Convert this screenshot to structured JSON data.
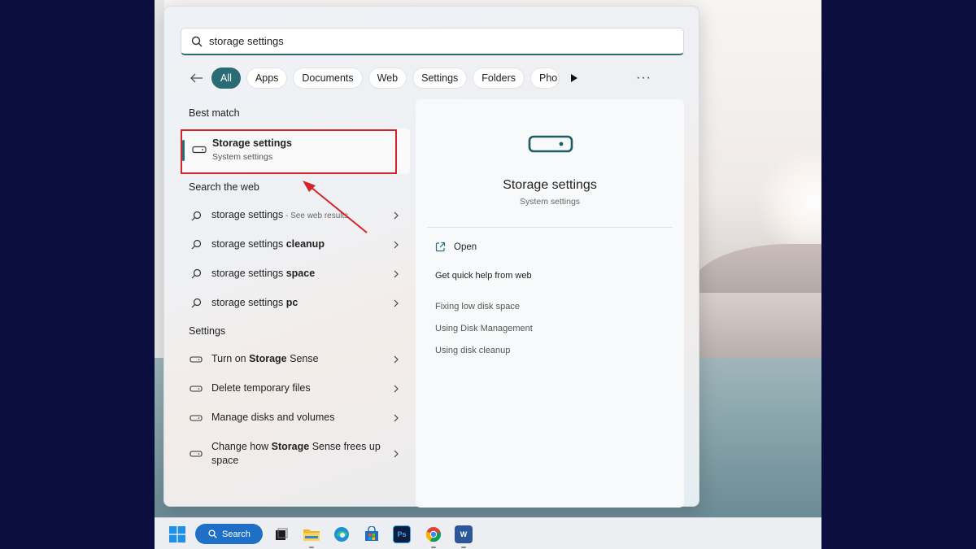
{
  "search": {
    "query": "storage settings"
  },
  "filters": [
    "All",
    "Apps",
    "Documents",
    "Web",
    "Settings",
    "Folders",
    "Pho"
  ],
  "active_filter": "All",
  "more_label": "···",
  "best_match": {
    "header": "Best match",
    "title": "Storage settings",
    "subtitle": "System settings"
  },
  "web": {
    "header": "Search the web",
    "items": [
      {
        "pre": "storage settings",
        "bold": "",
        "suffix": " - See web results"
      },
      {
        "pre": "storage settings ",
        "bold": "cleanup",
        "suffix": ""
      },
      {
        "pre": "storage settings ",
        "bold": "space",
        "suffix": ""
      },
      {
        "pre": "storage settings ",
        "bold": "pc",
        "suffix": ""
      }
    ]
  },
  "settings": {
    "header": "Settings",
    "items": [
      {
        "pre": "Turn on ",
        "bold": "Storage",
        "post": " Sense"
      },
      {
        "pre": "Delete temporary files",
        "bold": "",
        "post": ""
      },
      {
        "pre": "Manage disks and volumes",
        "bold": "",
        "post": ""
      },
      {
        "pre": "Change how ",
        "bold": "Storage",
        "post": " Sense frees up space"
      }
    ]
  },
  "preview": {
    "title": "Storage settings",
    "subtitle": "System settings",
    "open_label": "Open",
    "help_header": "Get quick help from web",
    "links": [
      "Fixing low disk space",
      "Using Disk Management",
      "Using disk cleanup"
    ]
  },
  "taskbar": {
    "search_label": "Search",
    "apps": [
      "start-icon",
      "task-view-icon",
      "file-explorer-icon",
      "edge-icon",
      "store-icon",
      "photoshop-icon",
      "chrome-icon",
      "word-icon"
    ],
    "ps_label": "Ps",
    "word_label": "W"
  },
  "colors": {
    "accent": "#2b6b73",
    "highlight": "#d3242c",
    "taskbar_search": "#1f6fc6"
  }
}
